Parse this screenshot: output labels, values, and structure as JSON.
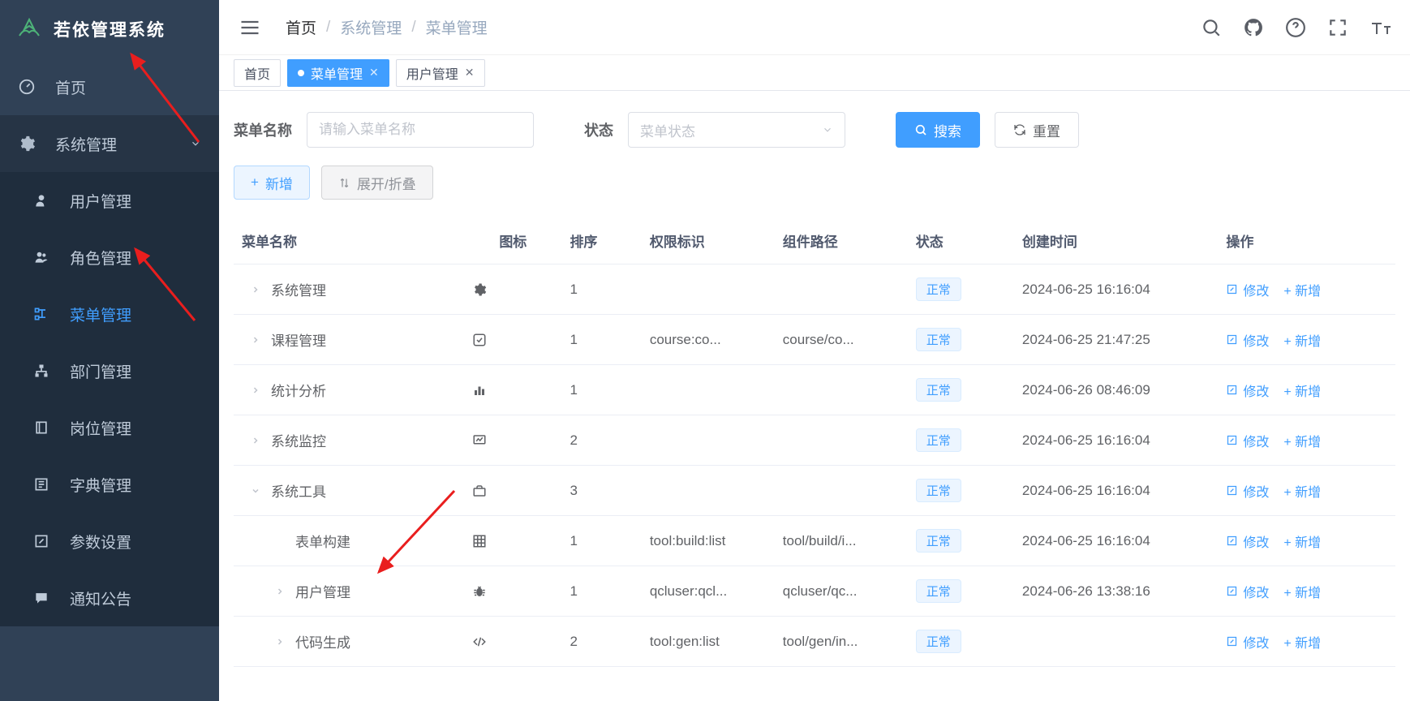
{
  "app": {
    "title": "若依管理系统"
  },
  "sidebar": {
    "home": "首页",
    "sys": "系统管理",
    "items": [
      {
        "label": "用户管理"
      },
      {
        "label": "角色管理"
      },
      {
        "label": "菜单管理"
      },
      {
        "label": "部门管理"
      },
      {
        "label": "岗位管理"
      },
      {
        "label": "字典管理"
      },
      {
        "label": "参数设置"
      },
      {
        "label": "通知公告"
      }
    ]
  },
  "breadcrumb": {
    "home": "首页",
    "sys": "系统管理",
    "menu": "菜单管理"
  },
  "tabs": {
    "home": "首页",
    "menu": "菜单管理",
    "user": "用户管理"
  },
  "search": {
    "name_label": "菜单名称",
    "name_placeholder": "请输入菜单名称",
    "status_label": "状态",
    "status_placeholder": "菜单状态",
    "search_btn": "搜索",
    "reset_btn": "重置"
  },
  "actions": {
    "add": "新增",
    "expand": "展开/折叠"
  },
  "table": {
    "headers": {
      "name": "菜单名称",
      "icon": "图标",
      "sort": "排序",
      "perm": "权限标识",
      "comp": "组件路径",
      "status": "状态",
      "time": "创建时间",
      "ops": "操作"
    },
    "status_ok": "正常",
    "op_edit": "修改",
    "op_add": "新增",
    "rows": [
      {
        "indent": 0,
        "expand": "right",
        "name": "系统管理",
        "icon": "gear",
        "sort": "1",
        "perm": "",
        "comp": "",
        "time": "2024-06-25 16:16:04"
      },
      {
        "indent": 0,
        "expand": "right",
        "name": "课程管理",
        "icon": "check",
        "sort": "1",
        "perm": "course:co...",
        "comp": "course/co...",
        "time": "2024-06-25 21:47:25"
      },
      {
        "indent": 0,
        "expand": "right",
        "name": "统计分析",
        "icon": "bar",
        "sort": "1",
        "perm": "",
        "comp": "",
        "time": "2024-06-26 08:46:09"
      },
      {
        "indent": 0,
        "expand": "right",
        "name": "系统监控",
        "icon": "monitor",
        "sort": "2",
        "perm": "",
        "comp": "",
        "time": "2024-06-25 16:16:04"
      },
      {
        "indent": 0,
        "expand": "down",
        "name": "系统工具",
        "icon": "toolbox",
        "sort": "3",
        "perm": "",
        "comp": "",
        "time": "2024-06-25 16:16:04"
      },
      {
        "indent": 1,
        "expand": "none",
        "name": "表单构建",
        "icon": "grid",
        "sort": "1",
        "perm": "tool:build:list",
        "comp": "tool/build/i...",
        "time": "2024-06-25 16:16:04"
      },
      {
        "indent": 1,
        "expand": "right",
        "name": "用户管理",
        "icon": "bug",
        "sort": "1",
        "perm": "qcluser:qcl...",
        "comp": "qcluser/qc...",
        "time": "2024-06-26 13:38:16"
      },
      {
        "indent": 1,
        "expand": "right",
        "name": "代码生成",
        "icon": "code",
        "sort": "2",
        "perm": "tool:gen:list",
        "comp": "tool/gen/in...",
        "time": ""
      }
    ]
  }
}
